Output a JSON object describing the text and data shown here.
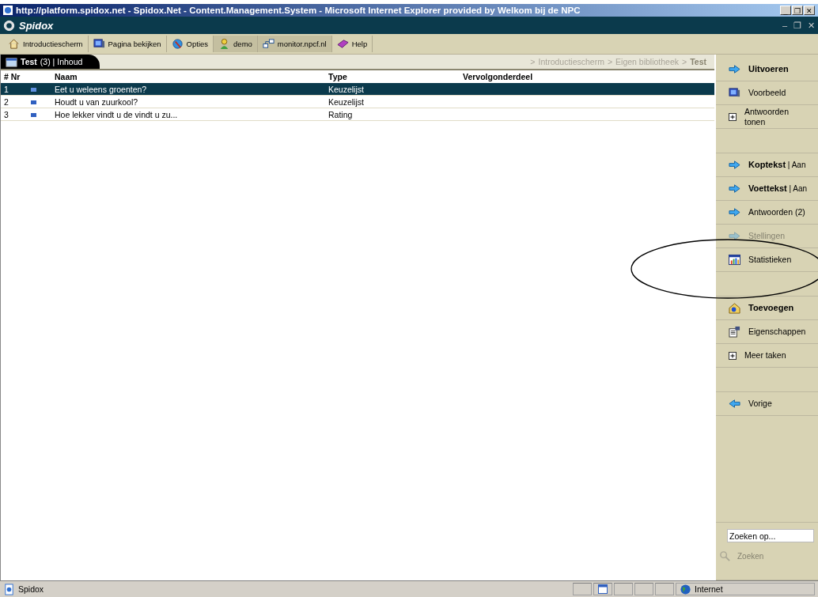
{
  "window": {
    "title": "http://platform.spidox.net - Spidox.Net - Content.Management.System - Microsoft Internet Explorer provided by Welkom bij de NPC",
    "controls": [
      "_",
      "❐",
      "✕"
    ]
  },
  "app": {
    "title": "Spidox",
    "controls": [
      "–",
      "❐",
      "✕"
    ]
  },
  "toolbar": [
    {
      "label": "Introductiescherm",
      "selected": false
    },
    {
      "label": "Pagina bekijken",
      "selected": false
    },
    {
      "label": "Opties",
      "selected": false
    },
    {
      "label": "demo",
      "selected": true
    },
    {
      "label": "monitor.npcf.nl",
      "selected": true
    },
    {
      "label": "Help",
      "selected": false
    }
  ],
  "tab": {
    "title": "Test",
    "count": "(3)",
    "separator": "|",
    "section": "Inhoud"
  },
  "breadcrumb": [
    {
      "sep": ">",
      "label": "Introductiescherm",
      "current": false
    },
    {
      "sep": ">",
      "label": "Eigen bibliotheek",
      "current": false
    },
    {
      "sep": ">",
      "label": "Test",
      "current": true
    }
  ],
  "table": {
    "columns": [
      "# Nr",
      "Naam",
      "Type",
      "Vervolgonderdeel"
    ],
    "rows": [
      {
        "nr": "1",
        "name": "Eet u weleens groenten?",
        "type": "Keuzelijst",
        "selected": true
      },
      {
        "nr": "2",
        "name": "Houdt u van zuurkool?",
        "type": "Keuzelijst",
        "selected": false
      },
      {
        "nr": "3",
        "name": "Hoe lekker vindt u de vindt u zu...",
        "type": "Rating",
        "selected": false
      }
    ]
  },
  "sidebar": {
    "groups": [
      [
        {
          "label": "Uitvoeren",
          "bold": true,
          "disabled": false
        },
        {
          "label": "Voorbeeld",
          "bold": false,
          "disabled": false
        },
        {
          "label": "Antwoorden tonen",
          "bold": false,
          "disabled": false
        }
      ],
      [
        {
          "label": "Koptekst",
          "suffix": "| Aan",
          "bold": true,
          "disabled": false
        },
        {
          "label": "Voettekst",
          "suffix": "| Aan",
          "bold": true,
          "disabled": false
        },
        {
          "label": "Antwoorden (2)",
          "bold": false,
          "disabled": false
        },
        {
          "label": "Stellingen",
          "bold": false,
          "disabled": true
        },
        {
          "label": "Statistieken",
          "bold": false,
          "disabled": false
        }
      ],
      [
        {
          "label": "Toevoegen",
          "bold": true,
          "disabled": false
        },
        {
          "label": "Eigenschappen",
          "bold": false,
          "disabled": false
        },
        {
          "label": "Meer taken",
          "bold": false,
          "disabled": false
        }
      ],
      [
        {
          "label": "Vorige",
          "bold": false,
          "disabled": false
        }
      ]
    ],
    "search": {
      "value": "Zoeken op...",
      "button": "Zoeken",
      "disabled": true
    }
  },
  "status_bar": {
    "text": "Spidox",
    "zone": "Internet"
  }
}
